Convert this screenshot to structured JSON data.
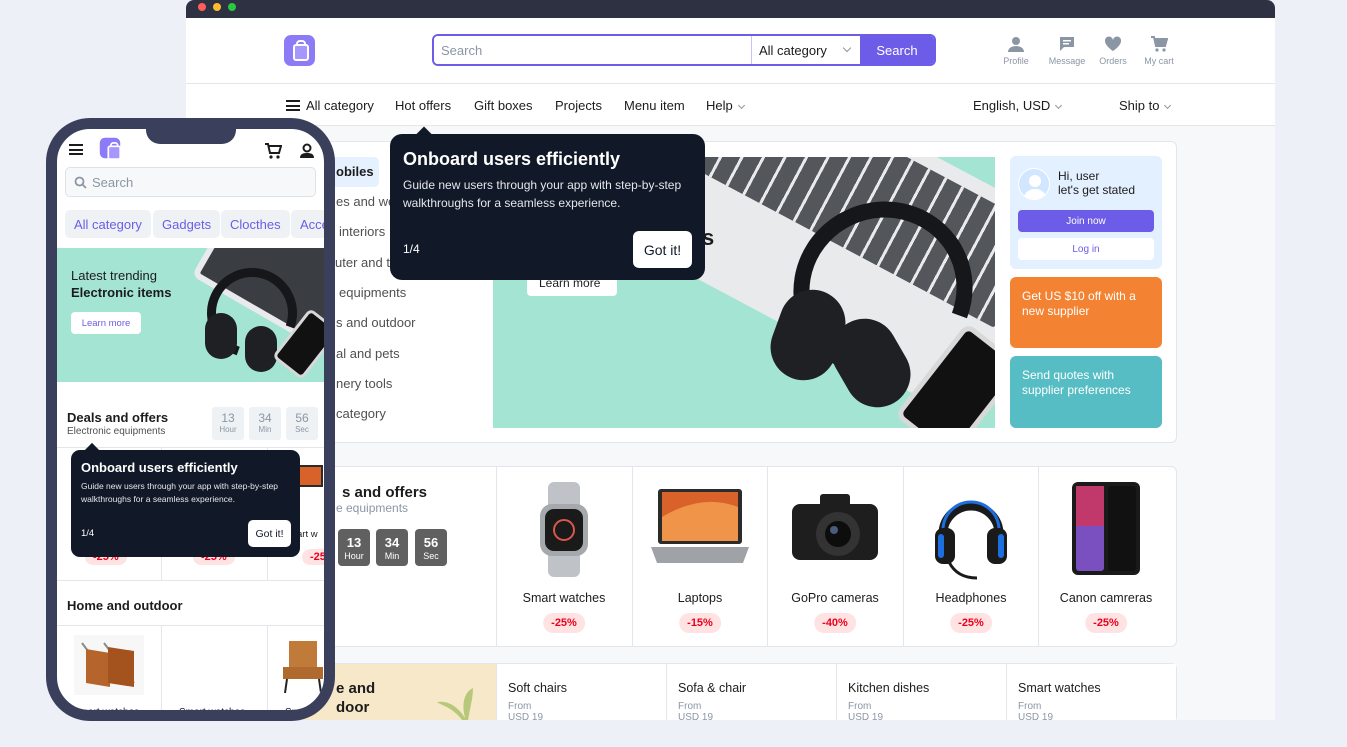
{
  "desktop": {
    "header": {
      "search_placeholder": "Search",
      "category_select": "All category",
      "search_button": "Search",
      "actions": [
        {
          "label": "Profile",
          "icon": "person-icon"
        },
        {
          "label": "Message",
          "icon": "message-icon"
        },
        {
          "label": "Orders",
          "icon": "heart-icon"
        },
        {
          "label": "My cart",
          "icon": "cart-icon"
        }
      ]
    },
    "nav": {
      "all_category": "All category",
      "items": [
        "Hot offers",
        "Gift boxes",
        "Projects",
        "Menu item",
        "Help"
      ],
      "language": "English, USD",
      "ship_to": "Ship to"
    },
    "sidebar_categories": [
      "obiles",
      "es and we",
      "interiors",
      "uter and t",
      "equipments",
      "s and outdoor",
      "al and pets",
      "nery tools",
      "category"
    ],
    "hero": {
      "partial_title": "s",
      "partial_button": "Learn more"
    },
    "user_box": {
      "greeting_line1": "Hi, user",
      "greeting_line2": "let's get stated",
      "join": "Join now",
      "login": "Log in"
    },
    "promos": [
      {
        "text": "Get US $10 off with a new supplier",
        "color": "#f38332"
      },
      {
        "text": "Send quotes with supplier preferences",
        "color": "#55bdc3"
      }
    ],
    "deals": {
      "title": "s and offers",
      "subtitle": "e equipments",
      "timer": [
        {
          "value": "13",
          "unit": "Hour"
        },
        {
          "value": "34",
          "unit": "Min"
        },
        {
          "value": "56",
          "unit": "Sec"
        }
      ],
      "products": [
        {
          "name": "Smart watches",
          "discount": "-25%"
        },
        {
          "name": "Laptops",
          "discount": "-15%"
        },
        {
          "name": "GoPro cameras",
          "discount": "-40%"
        },
        {
          "name": "Headphones",
          "discount": "-25%"
        },
        {
          "name": "Canon camreras",
          "discount": "-25%"
        }
      ]
    },
    "home_outdoor": {
      "title_line1": "e and",
      "title_line2": "door",
      "items": [
        {
          "name": "Soft chairs",
          "from": "From",
          "price": "USD 19"
        },
        {
          "name": "Sofa & chair",
          "from": "From",
          "price": "USD 19"
        },
        {
          "name": "Kitchen dishes",
          "from": "From",
          "price": "USD 19"
        },
        {
          "name": "Smart watches",
          "from": "From",
          "price": "USD 19"
        }
      ]
    },
    "tooltip": {
      "title": "Onboard users efficiently",
      "body": "Guide new users through your app with step-by-step walkthroughs for a seamless experience.",
      "step": "1/4",
      "button": "Got it!"
    }
  },
  "mobile": {
    "search_placeholder": "Search",
    "chips": [
      "All category",
      "Gadgets",
      "Clocthes",
      "Acce"
    ],
    "hero": {
      "line1": "Latest trending",
      "line2": "Electronic items",
      "button": "Learn more"
    },
    "deals": {
      "title": "Deals and offers",
      "subtitle": "Electronic equipments",
      "timer": [
        {
          "value": "13",
          "unit": "Hour"
        },
        {
          "value": "34",
          "unit": "Min"
        },
        {
          "value": "56",
          "unit": "Sec"
        }
      ],
      "badges": [
        "-25%",
        "-25%",
        "-25"
      ],
      "partial_item": "art w"
    },
    "home_outdoor": {
      "title": "Home and outdoor",
      "items": [
        "Smart watches",
        "Smart watches",
        "Smar"
      ]
    },
    "tooltip": {
      "title": "Onboard users efficiently",
      "body": "Guide new users through your app with step-by-step walkthroughs for a seamless experience.",
      "step": "1/4",
      "button": "Got it!"
    }
  }
}
